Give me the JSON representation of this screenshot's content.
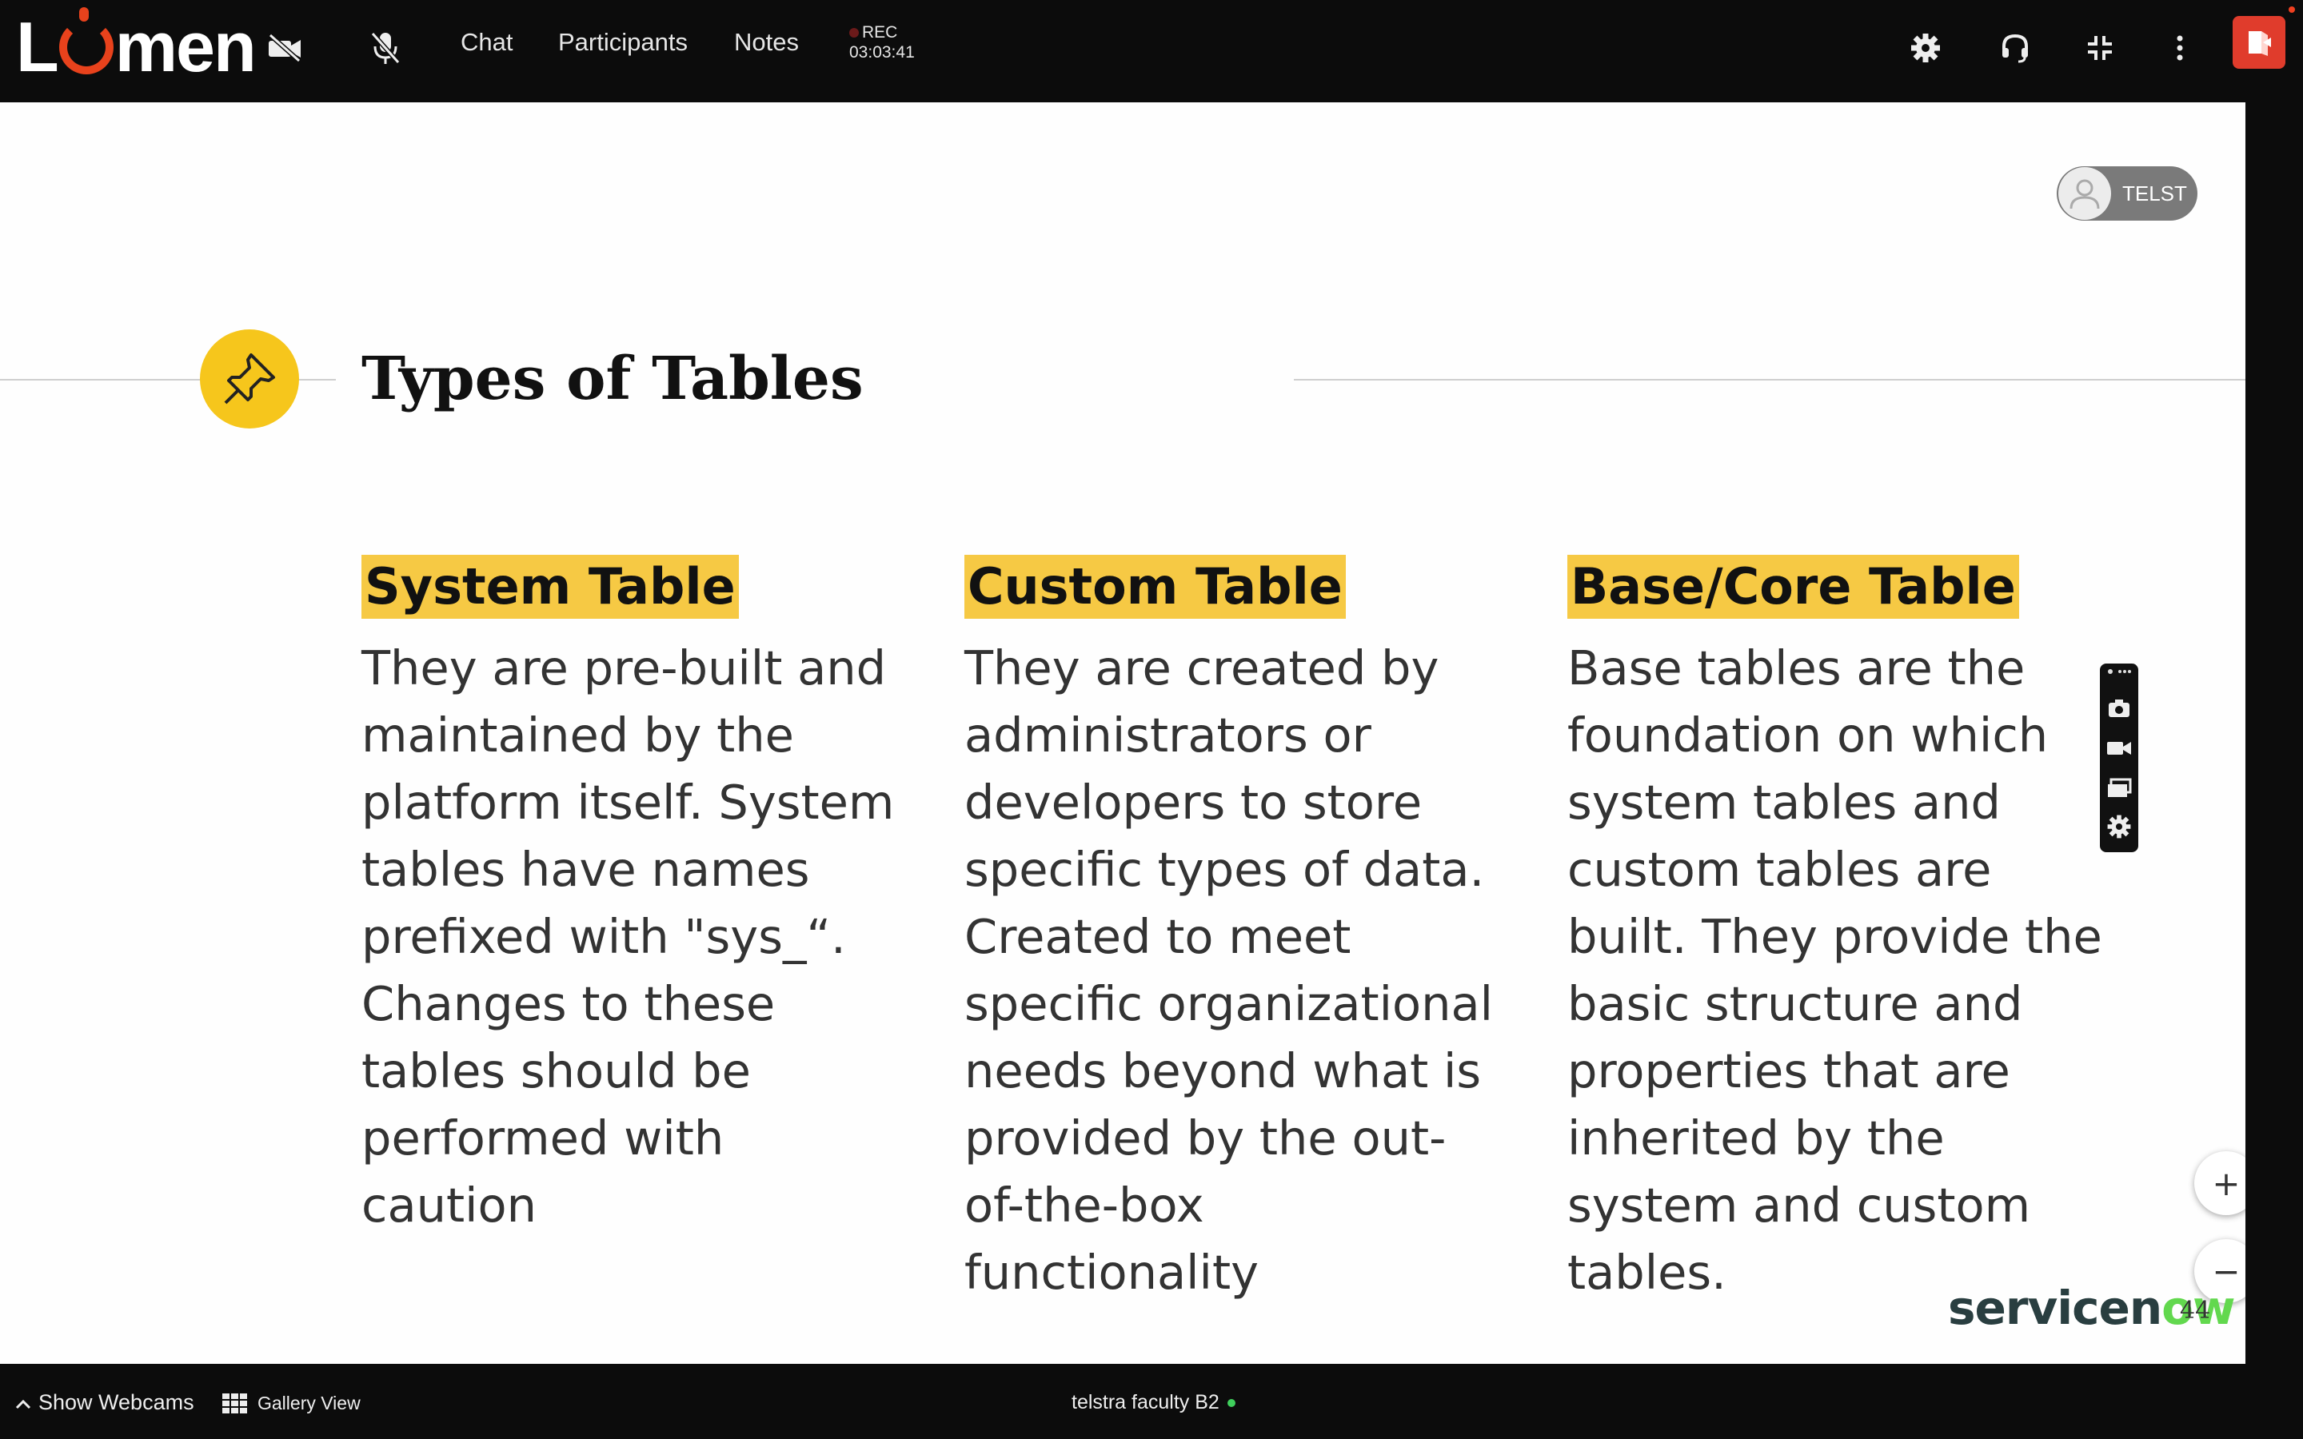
{
  "app": {
    "logo_text": "Lumen",
    "nav": {
      "chat": "Chat",
      "participants": "Participants",
      "notes": "Notes"
    },
    "recording": {
      "label": "REC",
      "time": "03:03:41"
    },
    "icons": [
      "camera-off-icon",
      "mic-off-icon",
      "gear-icon",
      "headset-icon",
      "exit-fullscreen-icon",
      "more-vertical-icon",
      "leave-icon"
    ]
  },
  "slide": {
    "title": "Types of Tables",
    "presenter_label": "TELST",
    "columns": [
      {
        "heading": "System Table",
        "body": "They are pre-built and\nmaintained by the\nplatform itself. System\ntables have names\nprefixed with \"sys_“.\nChanges to these\ntables should be\nperformed with\ncaution"
      },
      {
        "heading": "Custom Table",
        "body": "They are created by\nadministrators or\ndevelopers to store\nspecific types of data.\nCreated to meet\nspecific organizational\nneeds beyond what is\nprovided by the out-\nof-the-box\nfunctionality"
      },
      {
        "heading": "Base/Core Table",
        "body": "Base tables are the\nfoundation on which\nsystem tables and\ncustom tables are\nbuilt. They provide the\nbasic structure and\nproperties that are\ninherited by the\nsystem and custom\ntables."
      }
    ],
    "brand": {
      "part1": "servicen",
      "part2": "ow"
    },
    "page_number": "44",
    "zoom": {
      "in": "+",
      "out": "−"
    }
  },
  "bottom": {
    "show_webcams": "Show Webcams",
    "gallery_view": "Gallery View",
    "session_name": "telstra faculty B2"
  },
  "colors": {
    "accent_yellow": "#f6c944",
    "leave_red": "#e03c2c",
    "online_green": "#3fcf5c"
  }
}
